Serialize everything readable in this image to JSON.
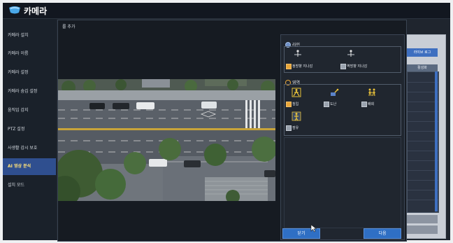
{
  "app": {
    "title": "카메라",
    "icon": "camera-app-icon"
  },
  "sidebar": {
    "items": [
      {
        "label": "카메라 설치",
        "active": false
      },
      {
        "label": "카메라 이름",
        "active": false
      },
      {
        "label": "카메라 설정",
        "active": false
      },
      {
        "label": "카메라 숨김 설정",
        "active": false
      },
      {
        "label": "움직임 감지",
        "active": false
      },
      {
        "label": "PTZ 설정",
        "active": false
      },
      {
        "label": "사생활 감시 보호",
        "active": false
      },
      {
        "label": "AI 영상 분석",
        "active": true
      },
      {
        "label": "설치 모드",
        "active": false
      }
    ]
  },
  "background": {
    "log_button": "라이브 로그",
    "column_header": "활성화"
  },
  "dialog": {
    "title": "룰 추가",
    "line_group": {
      "label": "라인",
      "options": [
        {
          "label": "정방향 지나감",
          "checked": true
        },
        {
          "label": "역방향 지나감",
          "checked": false
        }
      ]
    },
    "area_group": {
      "label": "영역",
      "options": [
        {
          "label": "침입",
          "checked": true
        },
        {
          "label": "도난",
          "checked": false
        },
        {
          "label": "배회",
          "checked": false
        },
        {
          "label": "점유",
          "checked": false
        }
      ]
    },
    "buttons": {
      "close": "닫기",
      "next": "다음"
    }
  },
  "colors": {
    "accent": "#2f6fc4",
    "active_sidebar": "#2f4f8f",
    "checked": "#e9a63a"
  }
}
